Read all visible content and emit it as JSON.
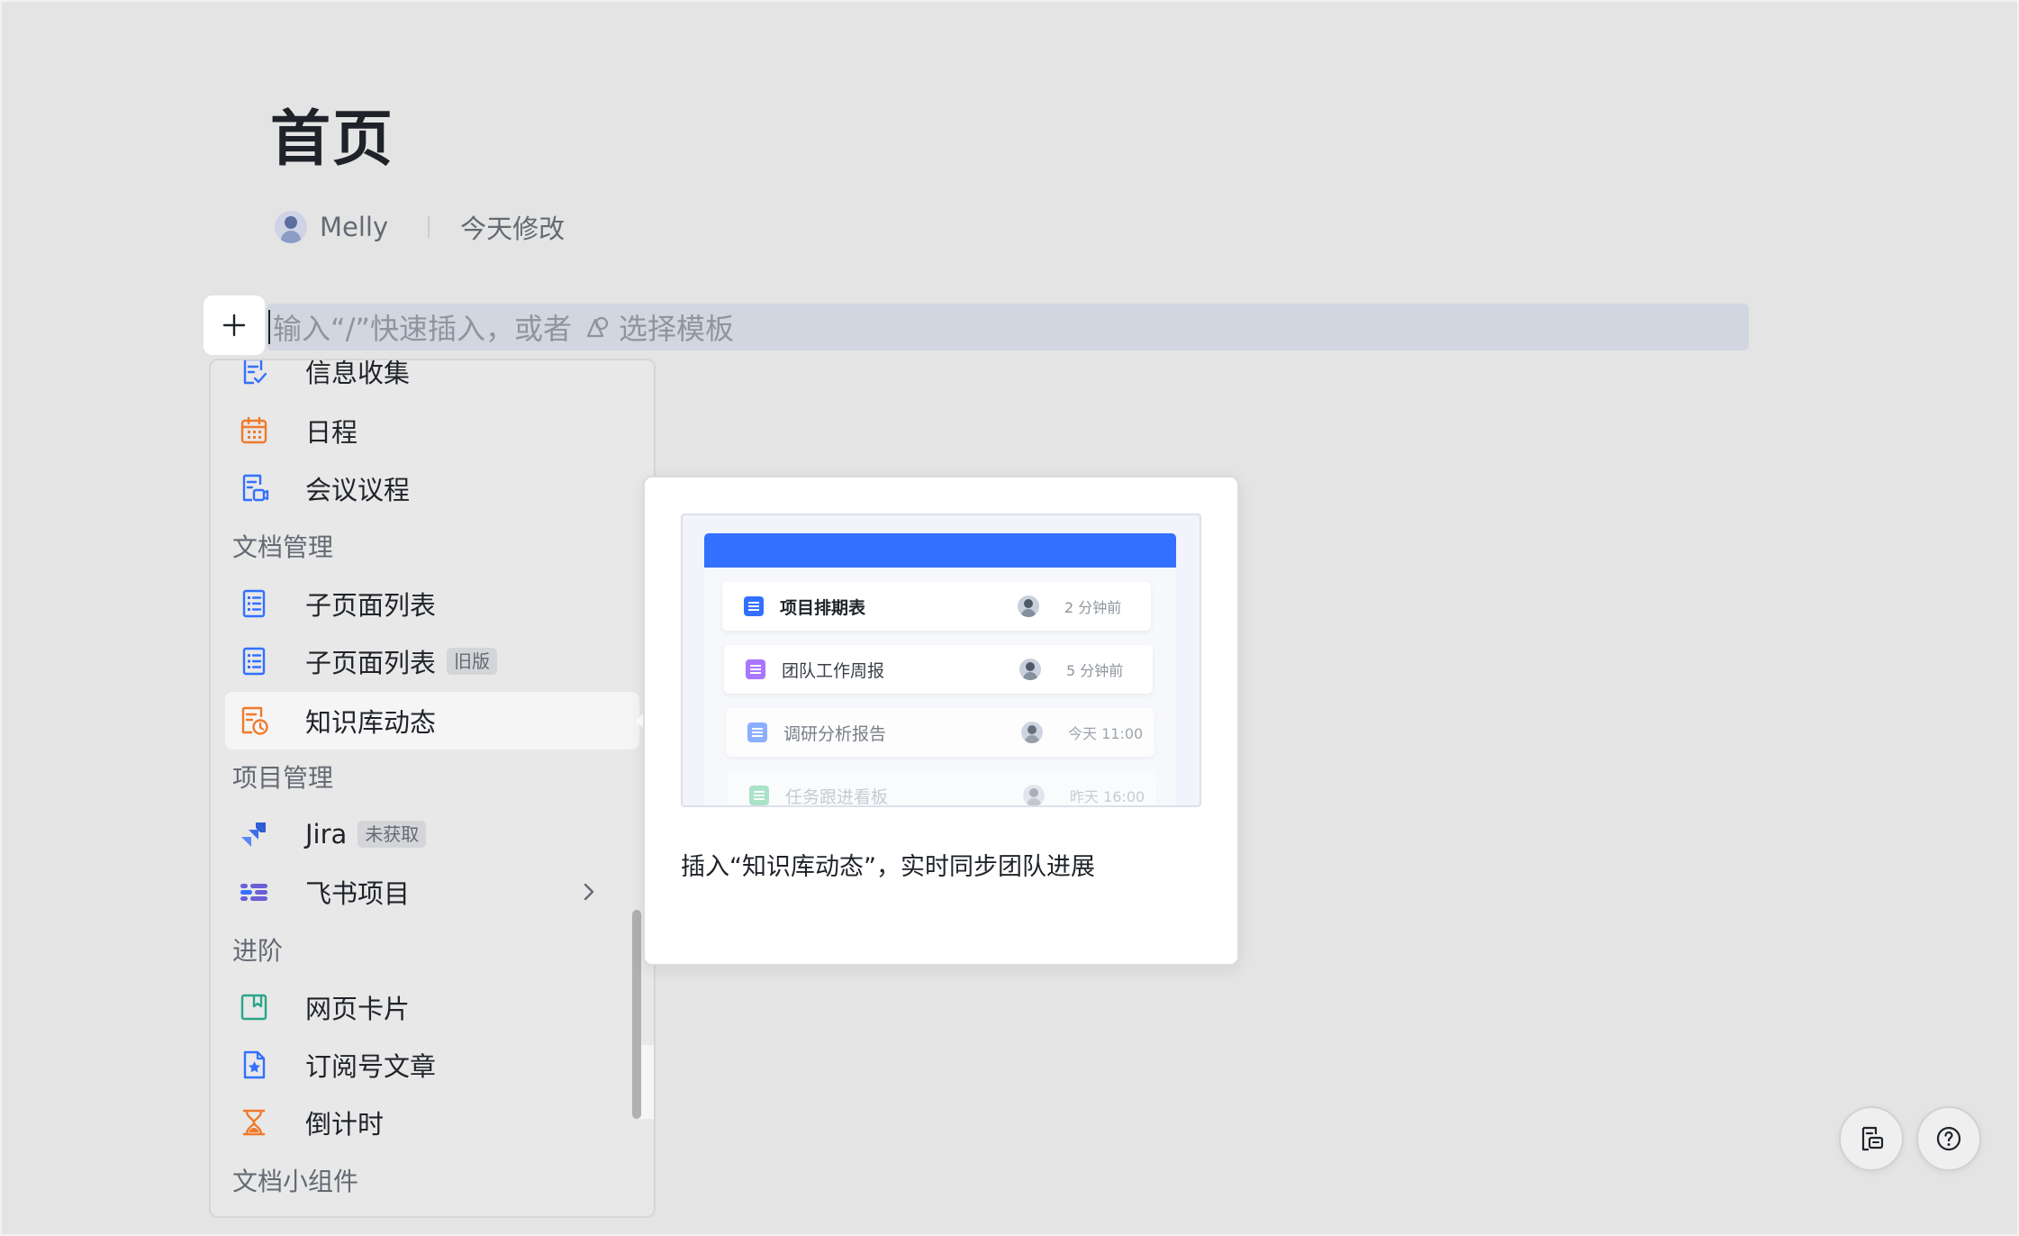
{
  "page": {
    "title": "首页"
  },
  "meta": {
    "author": "Melly",
    "modified": "今天修改"
  },
  "editor": {
    "placeholder_prefix": "输入“/”快速插入，或者",
    "template_link": "选择模板"
  },
  "menu": {
    "items_top": [
      {
        "label": "信息收集",
        "icon": "form-check-icon"
      },
      {
        "label": "日程",
        "icon": "calendar-icon"
      },
      {
        "label": "会议议程",
        "icon": "meeting-agenda-icon"
      }
    ],
    "section_docs": "文档管理",
    "items_docs": [
      {
        "label": "子页面列表",
        "icon": "subpage-list-icon"
      },
      {
        "label": "子页面列表",
        "tag": "旧版",
        "icon": "subpage-list-icon"
      },
      {
        "label": "知识库动态",
        "icon": "wiki-activity-icon"
      }
    ],
    "section_project": "项目管理",
    "items_project": [
      {
        "label": "Jira",
        "tag": "未获取",
        "icon": "jira-icon"
      },
      {
        "label": "飞书项目",
        "icon": "feishu-project-icon"
      }
    ],
    "section_advanced": "进阶",
    "items_advanced": [
      {
        "label": "网页卡片",
        "icon": "web-card-icon"
      },
      {
        "label": "订阅号文章",
        "icon": "subscription-article-icon"
      },
      {
        "label": "倒计时",
        "icon": "hourglass-icon"
      }
    ],
    "section_widgets": "文档小组件"
  },
  "preview": {
    "rows": [
      {
        "title": "项目排期表",
        "time": "2 分钟前",
        "color": "#3370ff"
      },
      {
        "title": "团队工作周报",
        "time": "5 分钟前",
        "color": "#a877ff"
      },
      {
        "title": "调研分析报告",
        "time": "今天 11:00",
        "color": "#7aa2ff"
      },
      {
        "title": "任务跟进看板",
        "time": "昨天 16:00",
        "color": "#4cc98b"
      }
    ],
    "description": "插入“知识库动态”，实时同步团队进展"
  },
  "colors": {
    "accent": "#3370ff",
    "orange": "#f07a2b",
    "teal": "#2aa58a",
    "purple": "#6b5fd6"
  }
}
